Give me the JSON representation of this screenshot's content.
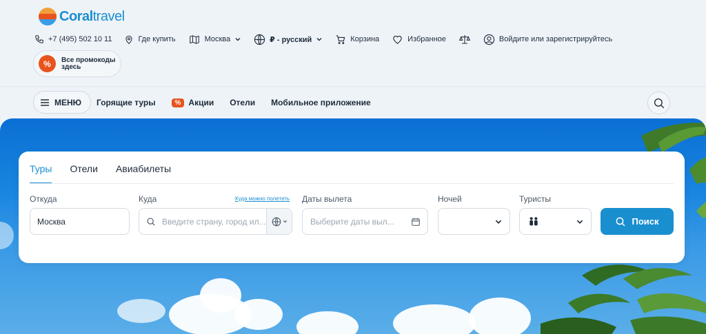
{
  "brand": {
    "logo_main": "Coral",
    "logo_sub": "travel",
    "logo_colors": [
      "#f08a24",
      "#e8541e",
      "#1a8fd0"
    ]
  },
  "topbar": {
    "phone": "+7 (495) 502 10 11",
    "where_to_buy": "Где купить",
    "city": "Москва",
    "currency_lang": "₽ - русский",
    "cart": "Корзина",
    "favorites": "Избранное",
    "login": "Войдите или зарегистрируйтесь"
  },
  "promo": {
    "badge": "%",
    "text": "Все промокоды здесь"
  },
  "nav": {
    "menu_label": "МЕНЮ",
    "links": [
      {
        "label": "Горящие туры"
      },
      {
        "label": "Акции",
        "tag": "%"
      },
      {
        "label": "Отели"
      },
      {
        "label": "Мобильное приложение"
      }
    ]
  },
  "search_form": {
    "tabs": [
      "Туры",
      "Отели",
      "Авиабилеты"
    ],
    "active_tab": "Туры",
    "from": {
      "label": "Откуда",
      "value": "Москва"
    },
    "to": {
      "label": "Куда",
      "hint_link": "Куда можно полететь",
      "placeholder": "Введите страну, город ил..."
    },
    "dates": {
      "label": "Даты вылета",
      "placeholder": "Выберите даты выл..."
    },
    "nights": {
      "label": "Ночей",
      "value": ""
    },
    "tourists": {
      "label": "Туристы"
    },
    "submit": "Поиск"
  },
  "colors": {
    "accent": "#1a8fd0",
    "promo": "#e8541e",
    "sky": "#1a86e0"
  }
}
